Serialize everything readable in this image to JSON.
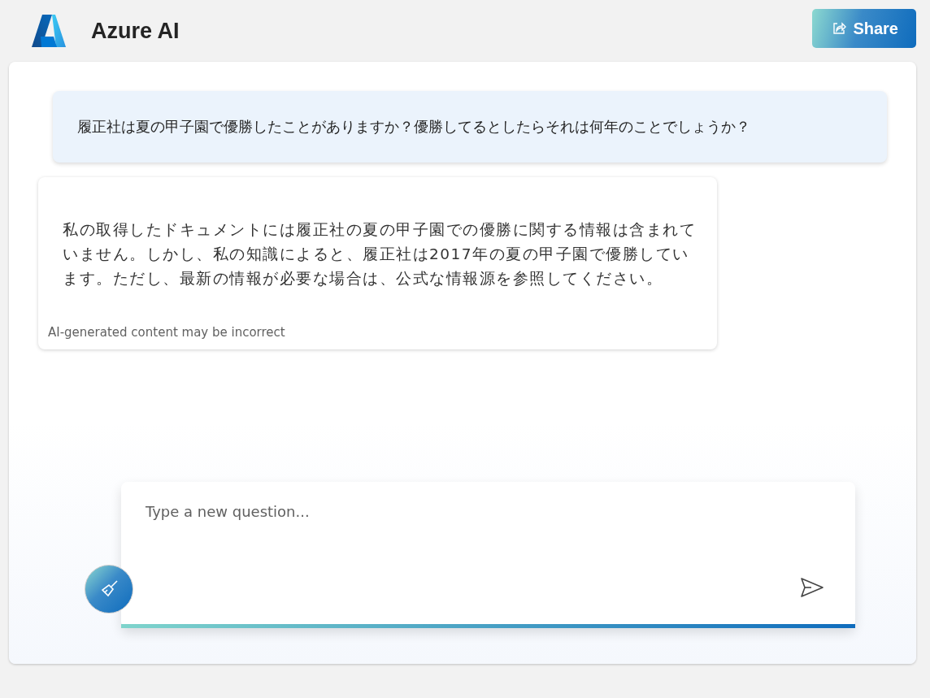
{
  "header": {
    "title": "Azure AI",
    "share_button": "Share"
  },
  "messages": [
    {
      "kind": "user",
      "text": "履正社は夏の甲子園で優勝したことがありますか？優勝してるとしたらそれは何年のことでしょうか？"
    },
    {
      "kind": "assistant",
      "text": "私の取得したドキュメントには履正社の夏の甲子園での優勝に関する情報は含まれていません。しかし、私の知識によると、履正社は2017年の夏の甲子園で優勝しています。ただし、最新の情報が必要な場合は、公式な情報源を参照してください。",
      "disclaimer": "AI-generated content may be incorrect"
    }
  ],
  "composer": {
    "placeholder": "Type a new question..."
  }
}
